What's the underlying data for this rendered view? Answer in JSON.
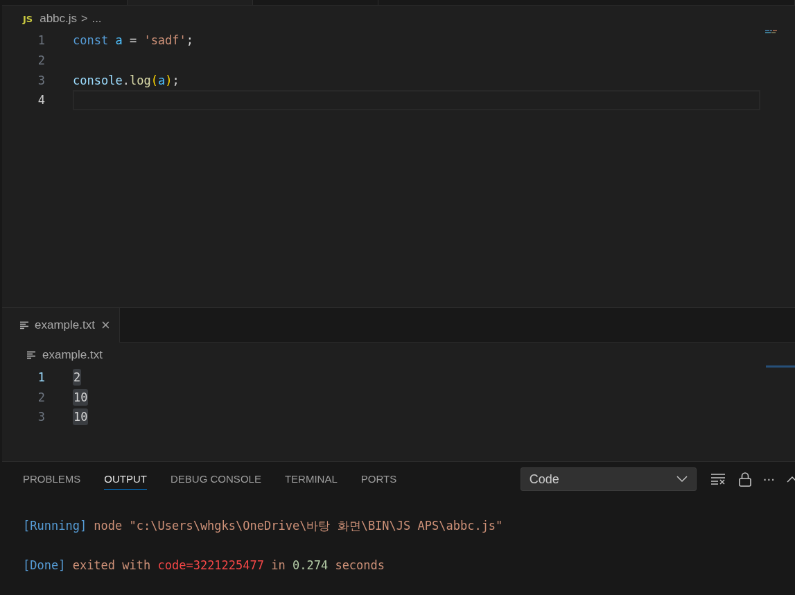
{
  "editor": {
    "breadcrumb": {
      "file_icon": "JS",
      "file": "abbc.js",
      "separator": ">",
      "more": "..."
    },
    "lines": [
      {
        "number": "1",
        "current": false,
        "tokens": [
          {
            "kind": "keyword",
            "text": "const "
          },
          {
            "kind": "variable",
            "text": "a "
          },
          {
            "kind": "punct",
            "text": "= "
          },
          {
            "kind": "string",
            "text": "'sadf'"
          },
          {
            "kind": "punct",
            "text": ";"
          }
        ]
      },
      {
        "number": "2",
        "current": false
      },
      {
        "number": "3",
        "current": false,
        "tokens": [
          {
            "kind": "object",
            "text": "console"
          },
          {
            "kind": "punct",
            "text": "."
          },
          {
            "kind": "function",
            "text": "log"
          },
          {
            "kind": "paren",
            "text": "("
          },
          {
            "kind": "variable",
            "text": "a"
          },
          {
            "kind": "paren",
            "text": ")"
          },
          {
            "kind": "punct",
            "text": ";"
          }
        ]
      },
      {
        "number": "4",
        "current": true
      }
    ]
  },
  "second_editor": {
    "tabs": [
      {
        "label": "example.txt",
        "selected": true
      }
    ],
    "close": "×",
    "breadcrumb": "example.txt",
    "lines": [
      {
        "number": "1",
        "current": true,
        "text": "2"
      },
      {
        "number": "2",
        "current": false,
        "text": "10"
      },
      {
        "number": "3",
        "current": false,
        "text": "10"
      }
    ]
  },
  "panel": {
    "tabs": [
      {
        "label": "PROBLEMS",
        "selected": false
      },
      {
        "label": "OUTPUT",
        "selected": true
      },
      {
        "label": "DEBUG CONSOLE",
        "selected": false
      },
      {
        "label": "TERMINAL",
        "selected": false
      },
      {
        "label": "PORTS",
        "selected": false
      }
    ],
    "channel": "Code",
    "more": "···",
    "output": [
      [
        {
          "kind": "tag",
          "text": "[Running]"
        },
        {
          "kind": "text",
          "text": " node \"c:\\Users\\whgks\\OneDrive\\바탕 화면\\BIN\\JS APS\\abbc.js\""
        }
      ],
      [
        {
          "kind": "tag",
          "text": "[Done]"
        },
        {
          "kind": "text",
          "text": " exited with "
        },
        {
          "kind": "error",
          "text": "code=3221225477"
        },
        {
          "kind": "text",
          "text": " in "
        },
        {
          "kind": "number",
          "text": "0.274"
        },
        {
          "kind": "text",
          "text": " seconds"
        }
      ]
    ]
  }
}
